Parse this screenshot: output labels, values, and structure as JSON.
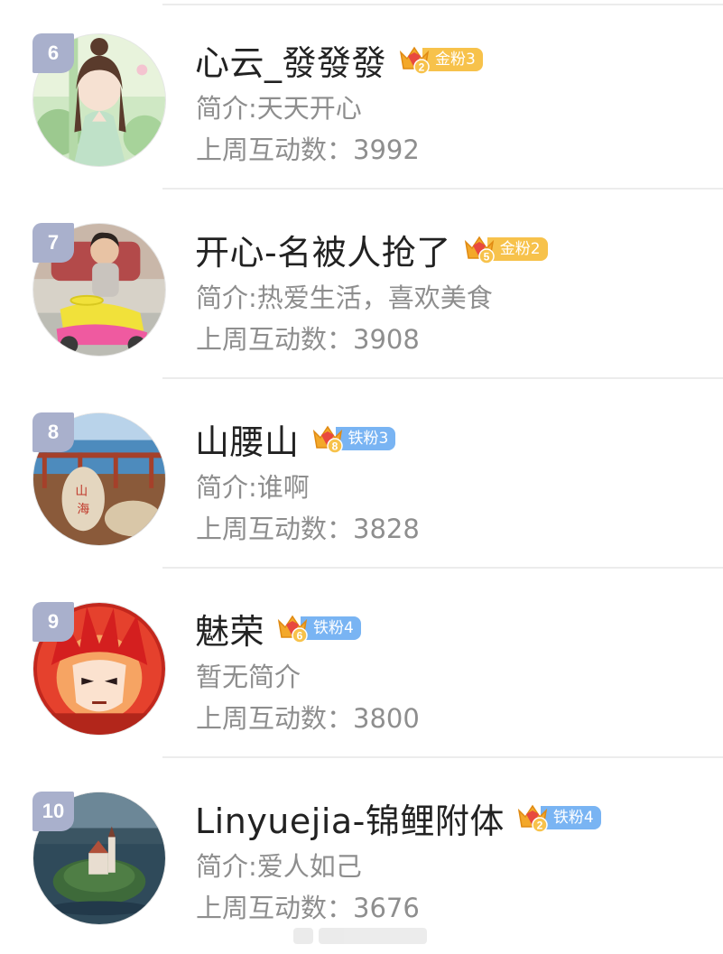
{
  "count_label": "上周互动数：",
  "colors": {
    "gold_badge": "#f7c24b",
    "iron_badge": "#79b4f3",
    "rank_bg": "#a9b0cc"
  },
  "users": [
    {
      "rank": "6",
      "name": "心云_發發發",
      "badge_num": "2",
      "badge_label": "金粉3",
      "badge_type": "gold",
      "bio": "简介:天天开心",
      "count": "3992",
      "avatar": "girl-illustration"
    },
    {
      "rank": "7",
      "name": "开心-名被人抢了",
      "badge_num": "5",
      "badge_label": "金粉2",
      "badge_type": "gold",
      "bio": "简介:热爱生活，喜欢美食",
      "count": "3908",
      "avatar": "child-on-toy-car"
    },
    {
      "rank": "8",
      "name": "山腰山",
      "badge_num": "8",
      "badge_label": "铁粉3",
      "badge_type": "iron",
      "bio": "简介:谁啊",
      "count": "3828",
      "avatar": "seaside-rocks"
    },
    {
      "rank": "9",
      "name": "魅荣",
      "badge_num": "6",
      "badge_label": "铁粉4",
      "badge_type": "iron",
      "bio": "暂无简介",
      "count": "3800",
      "avatar": "anime-warrior"
    },
    {
      "rank": "10",
      "name": "Linyuejia-锦鲤附体",
      "badge_num": "2",
      "badge_label": "铁粉4",
      "badge_type": "iron",
      "bio": "简介:爱人如己",
      "count": "3676",
      "avatar": "island-castle"
    }
  ]
}
